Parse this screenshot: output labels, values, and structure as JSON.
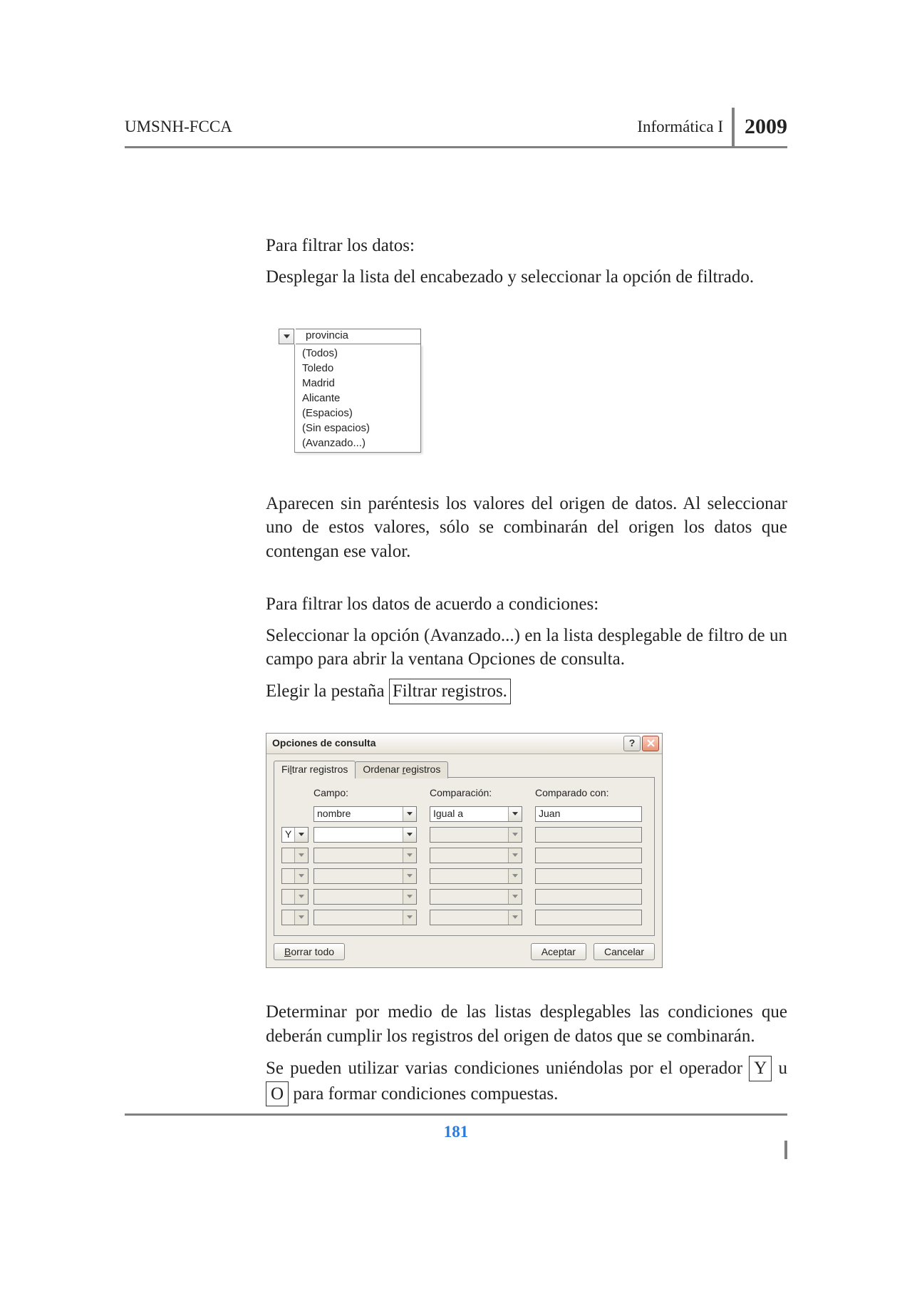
{
  "header": {
    "left": "UMSNH-FCCA",
    "course": "Informática I",
    "year": "2009"
  },
  "body": {
    "p1": "Para filtrar los datos:",
    "p2": "Desplegar la lista del encabezado y seleccionar la opción de filtrado.",
    "p3": "Aparecen sin paréntesis los valores del origen de datos. Al seleccionar uno de estos valores, sólo se combinarán del origen los datos que contengan ese valor.",
    "p4": "Para filtrar los datos de acuerdo a condiciones:",
    "p5": "Seleccionar la opción (Avanzado...) en la lista desplegable de filtro de un campo para abrir la ventana Opciones de consulta.",
    "p6_pre": "Elegir la pestaña ",
    "p6_box": "Filtrar registros.",
    "p7": "Determinar por medio de las listas desplegables las condiciones que deberán cumplir los registros del origen de datos que se combinarán.",
    "p8_1": "Se pueden utilizar varias condiciones uniéndolas por el operador ",
    "p8_Y": "Y",
    "p8_u": " u ",
    "p8_O": "O",
    "p8_2": " para formar condiciones compuestas."
  },
  "dropdown": {
    "header": "provincia",
    "items": [
      "(Todos)",
      "Toledo",
      "Madrid",
      "Alicante",
      "(Espacios)",
      "(Sin espacios)",
      "(Avanzado...)"
    ]
  },
  "dialog": {
    "title": "Opciones de consulta",
    "tab1_pre": "Fi",
    "tab1_u": "l",
    "tab1_post": "trar registros",
    "tab2_pre": "Ordenar ",
    "tab2_u": "r",
    "tab2_post": "egistros",
    "col_campo": "Campo:",
    "col_comp": "Comparación:",
    "col_val": "Comparado con:",
    "row1": {
      "campo": "nombre",
      "comp": "Igual a",
      "val": "Juan"
    },
    "row2": {
      "logic": "Y"
    },
    "btn_clear_u": "B",
    "btn_clear_rest": "orrar todo",
    "btn_ok": "Aceptar",
    "btn_cancel": "Cancelar"
  },
  "footer": {
    "page": "181"
  }
}
